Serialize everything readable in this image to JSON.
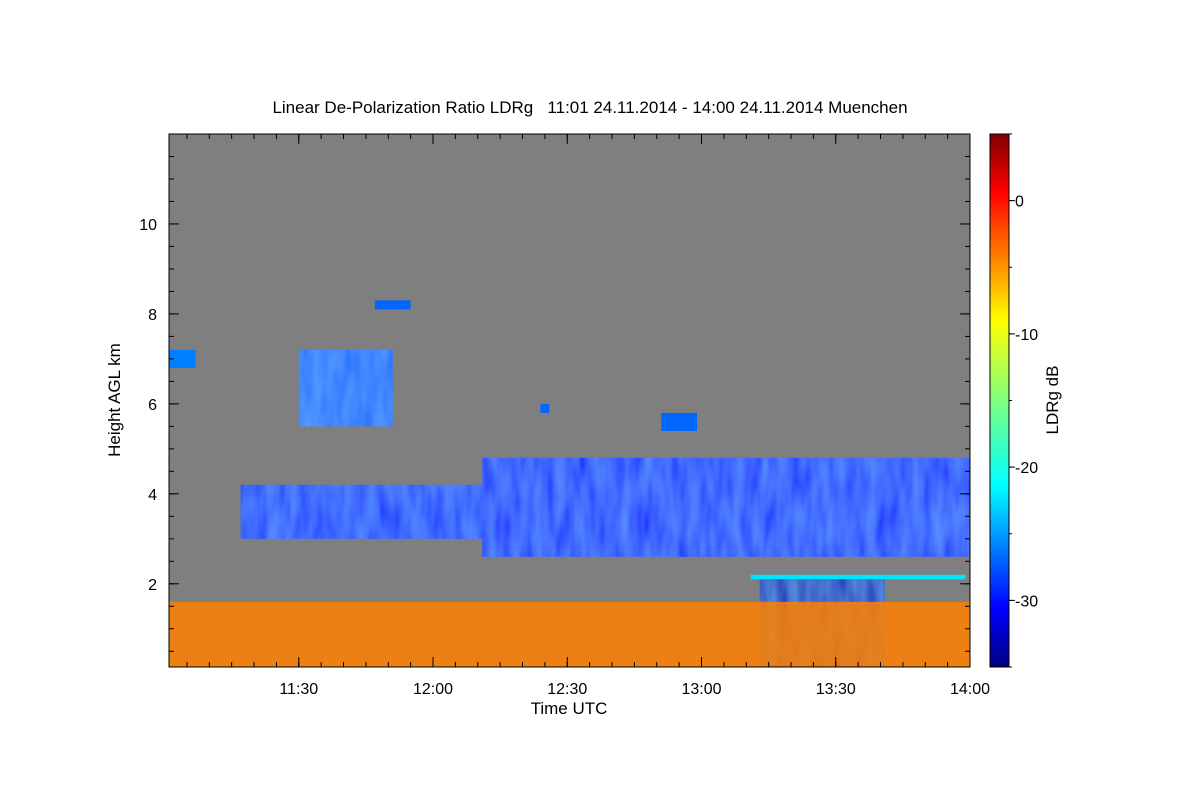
{
  "chart_data": {
    "type": "heatmap",
    "title": "Linear De-Polarization Ratio LDRg   11:01 24.11.2014 - 14:00 24.11.2014 Muenchen",
    "xlabel": "Time UTC",
    "ylabel": "Height AGL km",
    "colorbar_label": "LDRg dB",
    "x_range_minutes_utc": [
      661,
      840
    ],
    "y_range_km": [
      0.15,
      12
    ],
    "x_ticks": [
      {
        "value": 690,
        "label": "11:30"
      },
      {
        "value": 720,
        "label": "12:00"
      },
      {
        "value": 750,
        "label": "12:30"
      },
      {
        "value": 780,
        "label": "13:00"
      },
      {
        "value": 810,
        "label": "13:30"
      },
      {
        "value": 840,
        "label": "14:00"
      }
    ],
    "y_ticks": [
      {
        "value": 2,
        "label": "2"
      },
      {
        "value": 4,
        "label": "4"
      },
      {
        "value": 6,
        "label": "6"
      },
      {
        "value": 8,
        "label": "8"
      },
      {
        "value": 10,
        "label": "10"
      }
    ],
    "colorbar_range_db": [
      -35,
      5
    ],
    "colorbar_ticks": [
      {
        "value": 0,
        "label": "0"
      },
      {
        "value": -10,
        "label": "-10"
      },
      {
        "value": -20,
        "label": "-20"
      },
      {
        "value": -30,
        "label": "-30"
      }
    ],
    "colormap": "jet",
    "background_color": "#7f7f7f",
    "regions": [
      {
        "name": "cirrus patch",
        "time_start": 661,
        "time_end": 667,
        "h_bottom": 6.8,
        "h_top": 7.2,
        "ldr_db": -25
      },
      {
        "name": "cirrus patch",
        "time_start": 690,
        "time_end": 711,
        "h_bottom": 5.5,
        "h_top": 7.2,
        "ldr_db": -26
      },
      {
        "name": "cirrus patch",
        "time_start": 707,
        "time_end": 715,
        "h_bottom": 8.1,
        "h_top": 8.3,
        "ldr_db": -26
      },
      {
        "name": "cirrus patch",
        "time_start": 744,
        "time_end": 746,
        "h_bottom": 5.8,
        "h_top": 6.0,
        "ldr_db": -26
      },
      {
        "name": "cirrus patch",
        "time_start": 771,
        "time_end": 779,
        "h_bottom": 5.4,
        "h_top": 5.8,
        "ldr_db": -26
      },
      {
        "name": "thin cloud layer",
        "time_start": 677,
        "time_end": 733,
        "h_bottom": 3.0,
        "h_top": 4.2,
        "ldr_db": -29
      },
      {
        "name": "main cloud layer",
        "time_start": 731,
        "time_end": 840,
        "h_bottom": 2.6,
        "h_top": 4.8,
        "ldr_db": -30
      },
      {
        "name": "melting layer",
        "time_start": 791,
        "time_end": 839,
        "h_bottom": 2.1,
        "h_top": 2.2,
        "ldr_db": -21
      },
      {
        "name": "precipitation",
        "time_start": 793,
        "time_end": 821,
        "h_bottom": 0.15,
        "h_top": 2.1,
        "ldr_db": -33
      },
      {
        "name": "boundary layer aerosol",
        "time_start": 661,
        "time_end": 840,
        "h_bottom": 0.15,
        "h_top": 1.6,
        "ldr_db": -5
      }
    ]
  }
}
